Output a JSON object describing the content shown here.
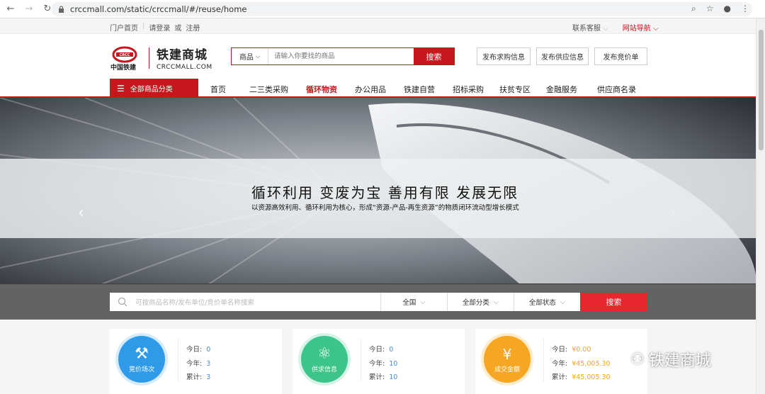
{
  "browser": {
    "url": "crccmall.com/static/crccmall/#/reuse/home"
  },
  "topbar": {
    "portal_home": "门户首页",
    "login": "请登录",
    "or": "或",
    "register": "注册",
    "customer_service": "联系客服",
    "site_nav": "网站导航"
  },
  "header": {
    "logo_text_cn": "铁建商城",
    "logo_text_en": "CRCCMALL.COM",
    "logo_sub": "中国铁建",
    "search_category": "商品",
    "search_placeholder": "请输入你要找的商品",
    "search_button": "搜索",
    "publish_buttons": [
      "发布求购信息",
      "发布供应信息",
      "发布竞价单"
    ]
  },
  "nav": {
    "all_categories": "全部商品分类",
    "items": [
      "首页",
      "二三类采购",
      "循环物资",
      "办公用品",
      "铁建自营",
      "招标采购",
      "扶贫专区",
      "金融服务",
      "供应商名录"
    ],
    "active_index": 2
  },
  "banner": {
    "headline": "循环利用  变废为宝  善用有限  发展无限",
    "subline": "以资源高效利用、循环利用为核心，形成“资源-产品-再生资源”的物质闭环流动型增长模式"
  },
  "search_bar": {
    "placeholder": "可按商品名称/发布单位/竞价单名称搜索",
    "region": "全国",
    "category": "全部分类",
    "status": "全部状态",
    "button": "搜索"
  },
  "cards": [
    {
      "label": "竞价场次",
      "color": "#2f9be8",
      "today_label": "今日:",
      "today": "0",
      "year_label": "今年:",
      "year": "3",
      "total_label": "累计:",
      "total": "3"
    },
    {
      "label": "供求信息",
      "color": "#3cc48a",
      "today_label": "今日:",
      "today": "0",
      "year_label": "今年:",
      "year": "10",
      "total_label": "累计:",
      "total": "10"
    },
    {
      "label": "成交金额",
      "color": "#f5a623",
      "today_label": "今日:",
      "today": "¥0.00",
      "year_label": "今年:",
      "year": "¥45,005.30",
      "total_label": "累计:",
      "total": "¥45,005.30"
    }
  ],
  "watermark": "铁建商城"
}
